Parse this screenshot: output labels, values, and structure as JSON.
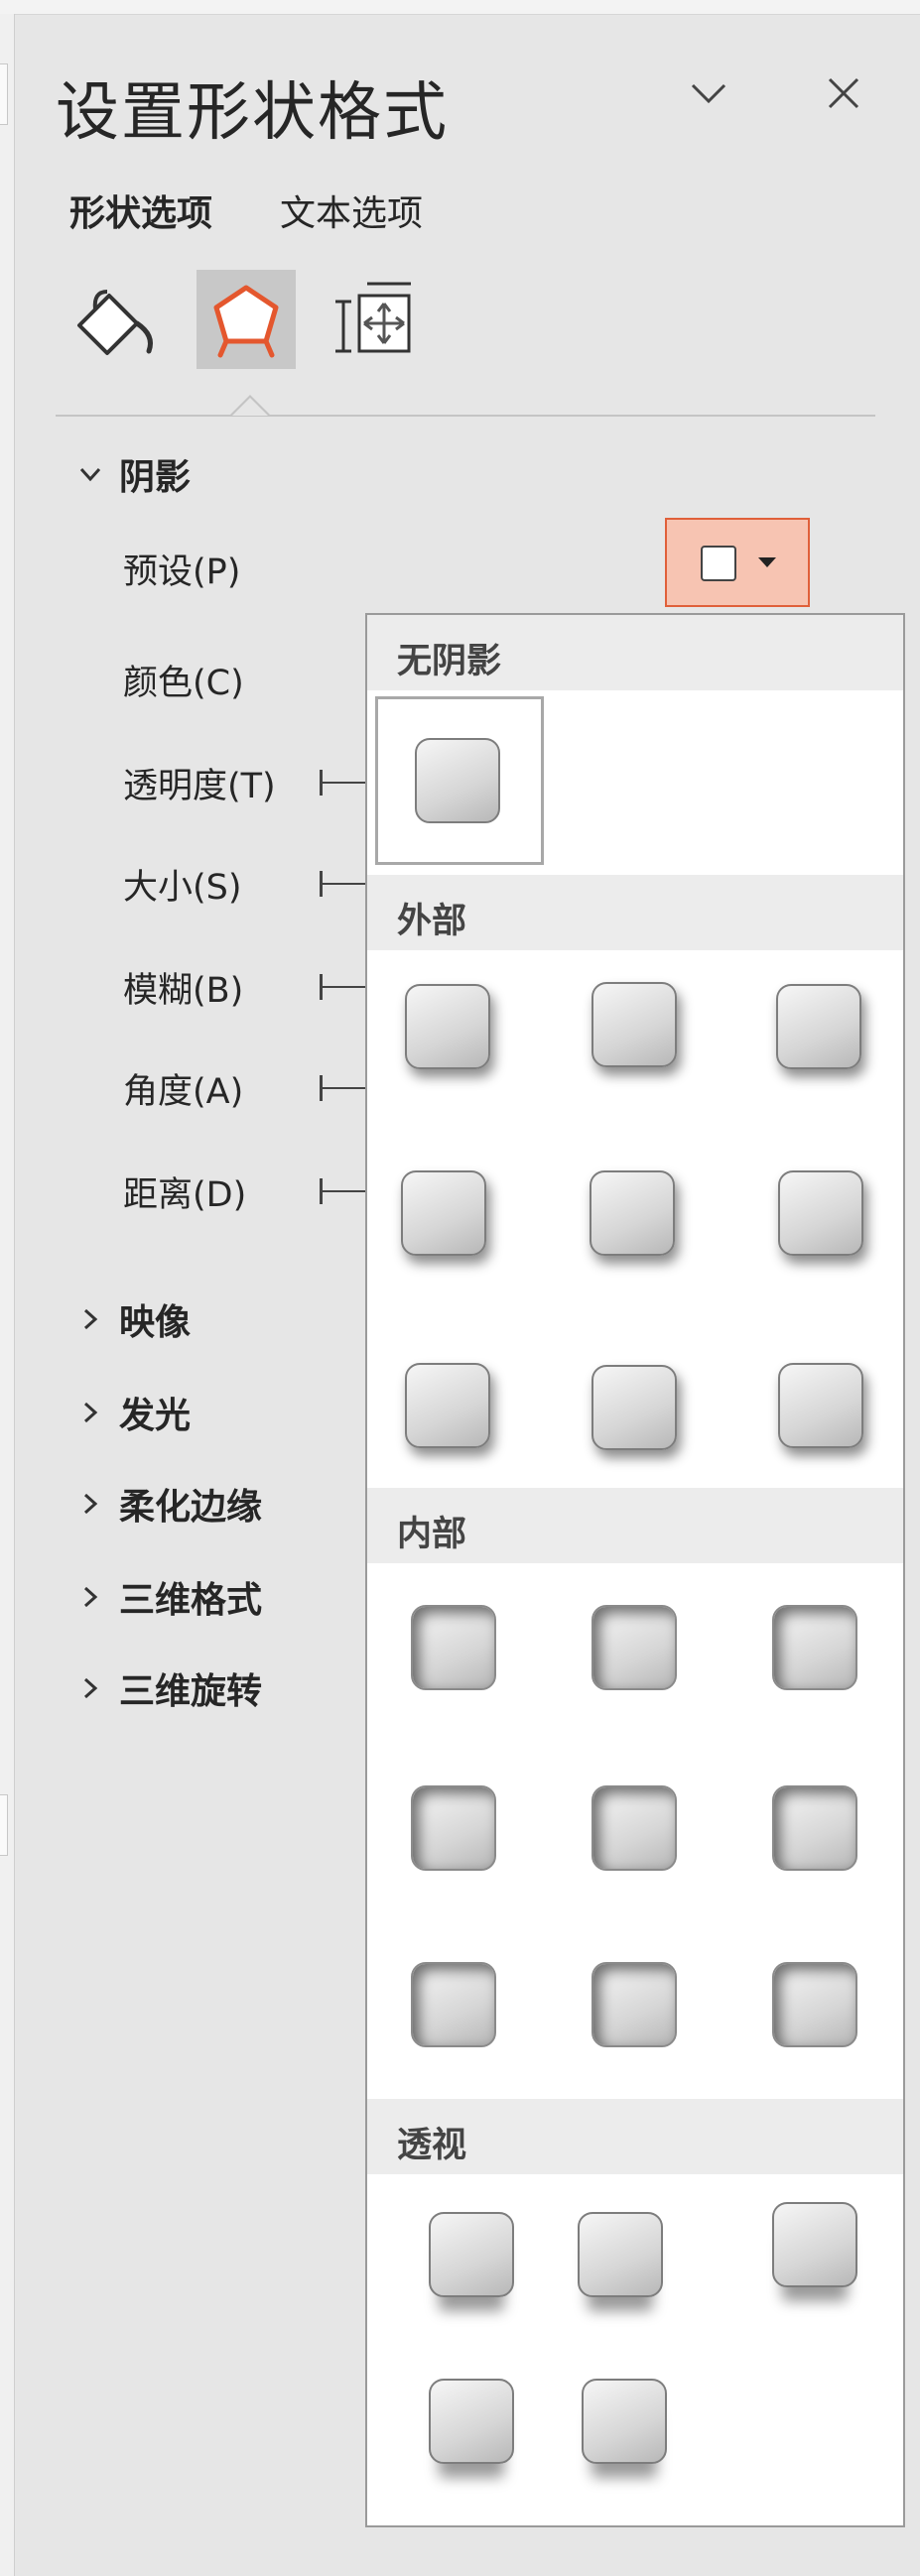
{
  "panel": {
    "title": "设置形状格式",
    "collapse_icon": "chevron-down-icon",
    "close_icon": "close-icon",
    "tabs": [
      {
        "label": "形状选项",
        "active": true
      },
      {
        "label": "文本选项",
        "active": false
      }
    ],
    "categories": [
      {
        "icon": "fill-line-icon",
        "selected": false
      },
      {
        "icon": "effects-pentagon-icon",
        "selected": true
      },
      {
        "icon": "size-properties-icon",
        "selected": false
      }
    ]
  },
  "shadow": {
    "label": "阴影",
    "expanded": true,
    "props": {
      "preset": "预设(P)",
      "color": "颜色(C)",
      "transparency": "透明度(T)",
      "size": "大小(S)",
      "blur": "模糊(B)",
      "angle": "角度(A)",
      "distance": "距离(D)"
    }
  },
  "sections": [
    "映像",
    "发光",
    "柔化边缘",
    "三维格式",
    "三维旋转"
  ],
  "preset_popup": {
    "groups": [
      {
        "label": "无阴影",
        "count": 1
      },
      {
        "label": "外部",
        "count": 9
      },
      {
        "label": "内部",
        "count": 9
      },
      {
        "label": "透视",
        "count": 5
      }
    ]
  },
  "colors": {
    "accent_border": "#e0603a",
    "accent_fill": "#f7c4b2",
    "icon_red": "#e4572e"
  }
}
